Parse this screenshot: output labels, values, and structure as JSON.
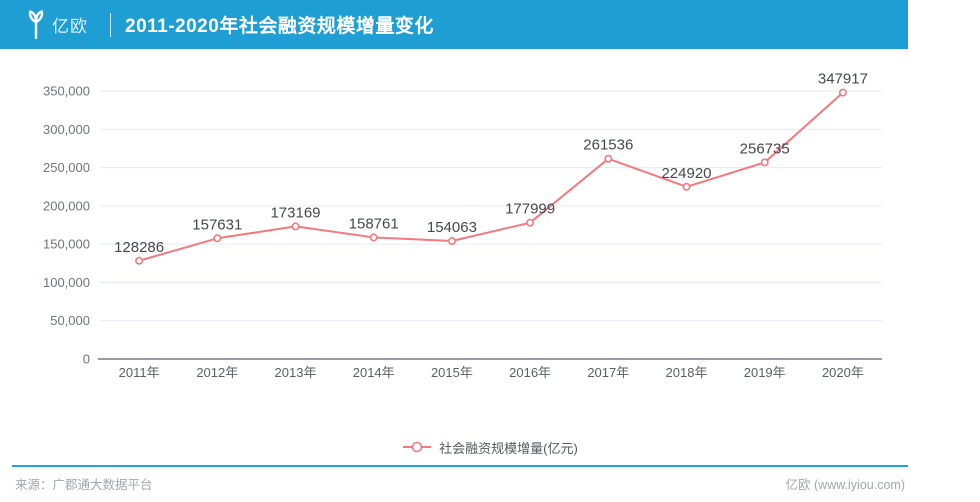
{
  "header": {
    "logo_text": "亿欧",
    "title": "2011-2020年社会融资规模增量变化"
  },
  "chart_data": {
    "type": "line",
    "title": "2011-2020年社会融资规模增量变化",
    "categories": [
      "2011年",
      "2012年",
      "2013年",
      "2014年",
      "2015年",
      "2016年",
      "2017年",
      "2018年",
      "2019年",
      "2020年"
    ],
    "series": [
      {
        "name": "社会融资规模增量(亿元)",
        "values": [
          128286,
          157631,
          173169,
          158761,
          154063,
          177999,
          261536,
          224920,
          256735,
          347917
        ]
      }
    ],
    "ylim": [
      0,
      350000
    ],
    "y_tick_step": 50000,
    "y_tick_labels": [
      "0",
      "50,000",
      "100,000",
      "150,000",
      "200,000",
      "250,000",
      "300,000",
      "350,000"
    ],
    "grid": true,
    "legend_position": "bottom",
    "line_color": "#f4787f",
    "marker_fill": "#ffffff",
    "label_color": "#45484d"
  },
  "legend": {
    "label": "社会融资规模增量(亿元)"
  },
  "footer": {
    "source": "来源：广郡通大数据平台",
    "credit": "亿欧 (www.iyiou.com)"
  },
  "colors": {
    "header_bg": "#1e9ed2",
    "divider_blue": "#22a3de",
    "grid_line": "#e4eaf5",
    "axis_line": "#989da5",
    "y_label": "#70747c",
    "x_label": "#5c6066"
  }
}
